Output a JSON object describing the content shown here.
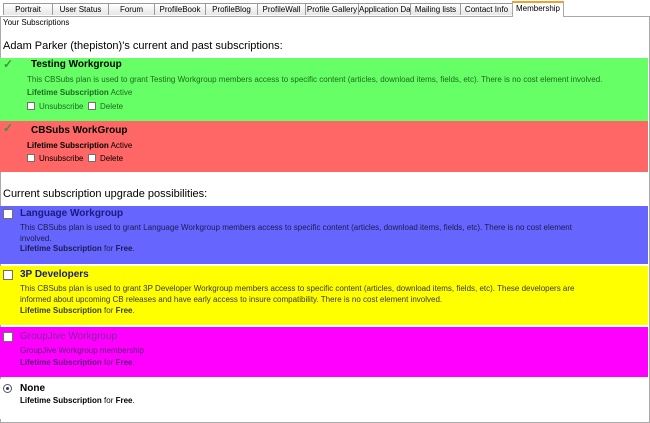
{
  "tabs": [
    "Portrait",
    "User Status",
    "Forum",
    "ProfileBook",
    "ProfileBlog",
    "ProfileWall",
    "Profile Gallery",
    "Application Dat",
    "Mailing lists",
    "Contact Info",
    "Membership"
  ],
  "page": {
    "section_label": "Your Subscriptions",
    "current_heading": "Adam Parker (thepiston)'s current and past subscriptions:",
    "upgrade_heading": "Current subscription upgrade possibilities:"
  },
  "current": [
    {
      "title": "Testing Workgroup",
      "description": "This CBSubs plan is used to grant Testing Workgroup members access to specific content (articles, download items, fields, etc). There is no cost element involved.",
      "status_label": "Lifetime Subscription",
      "status": "Active",
      "unsubscribe": "Unsubscribe",
      "delete": "Delete",
      "color": "#66ff66"
    },
    {
      "title": "CBSubs WorkGroup",
      "status_label": "Lifetime Subscription",
      "status": "Active",
      "unsubscribe": "Unsubscribe",
      "delete": "Delete",
      "color": "#ff6666"
    }
  ],
  "upgrades": [
    {
      "title": "Language Workgroup",
      "description": "This CBSubs plan is used to grant Language Workgroup members access to specific content (articles, download items, fields, etc). There is no cost element involved.",
      "price_label": "Lifetime Subscription",
      "price_for": "for",
      "price": "Free",
      "color": "#6666ff",
      "title_color": "#1a1a80"
    },
    {
      "title": "3P Developers",
      "description": "This CBSubs plan is used to grant 3P Developer Workgroup members access to specific content (articles, download items, fields, etc). These developers are informed about upcoming CB releases and have early access to insure compatibility. There is no cost element involved.",
      "price_label": "Lifetime Subscription",
      "price_for": "for",
      "price": "Free",
      "color": "#ffff00",
      "title_color": "#1a1a80"
    },
    {
      "title": "GroupJive Workgroup",
      "description": "GroupJive Workgroup membership",
      "price_label": "Lifetime Subscription",
      "price_for": "for",
      "price": "Free",
      "color": "#ff00ff",
      "title_color": "#7a2a9a"
    },
    {
      "title": "None",
      "price_label": "Lifetime Subscription",
      "price_for": "for",
      "price": "Free",
      "color": "#ffffff",
      "title_color": "#000000"
    }
  ]
}
